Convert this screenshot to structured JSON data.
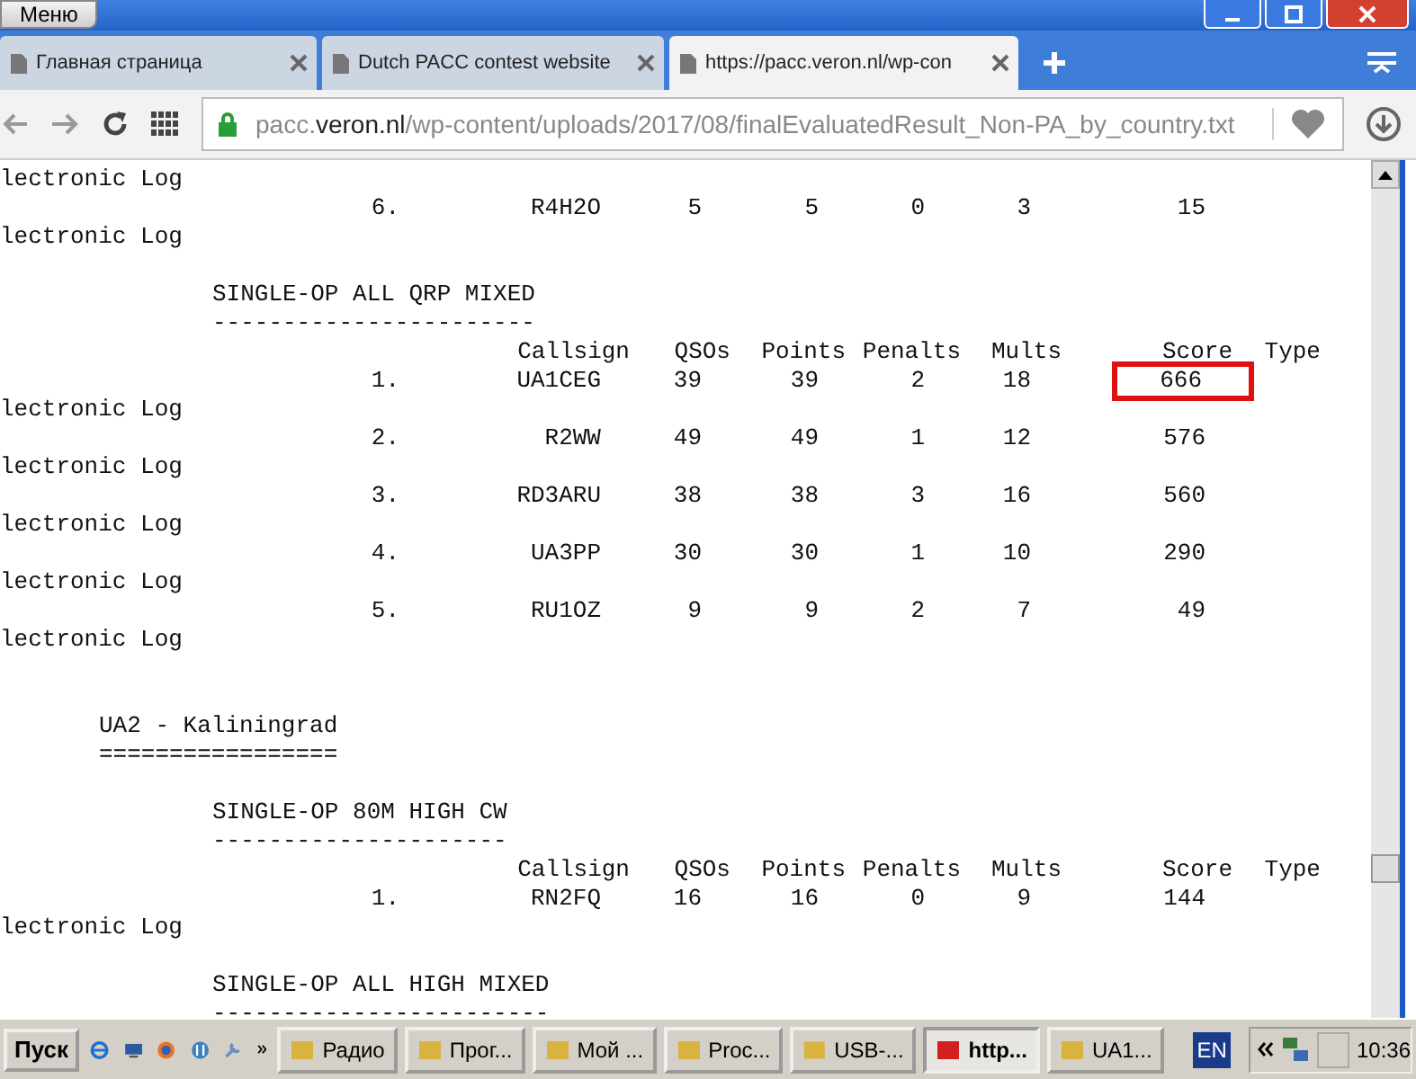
{
  "menu_button": "Меню",
  "tabs": [
    {
      "title": "Главная страница",
      "selected": false
    },
    {
      "title": "Dutch PACC contest website",
      "selected": false
    },
    {
      "title": "https://pacc.veron.nl/wp-con",
      "selected": true
    }
  ],
  "address": {
    "host_start": "pacc.",
    "domain": "veron.nl",
    "path": "/wp-content/uploads/2017/08/finalEvaluatedResult_Non-PA_by_country.txt"
  },
  "document_lines": [
    {
      "kind": "text",
      "text": "lectronic Log"
    },
    {
      "kind": "row",
      "cells": [
        "6.",
        "R4H2O",
        "5",
        "5",
        "0",
        "3",
        "15"
      ],
      "highlighted": false
    },
    {
      "kind": "text",
      "text": "lectronic Log"
    },
    {
      "kind": "blank"
    },
    {
      "kind": "heading",
      "text": "SINGLE-OP ALL QRP MIXED"
    },
    {
      "kind": "heading",
      "text": "-----------------------"
    },
    {
      "kind": "header",
      "cells": [
        "Callsign",
        "QSOs",
        "Points",
        "Penalts",
        "Mults",
        "Score",
        "Type"
      ]
    },
    {
      "kind": "row",
      "cells": [
        "1.",
        "UA1CEG",
        "39",
        "39",
        "2",
        "18",
        "666"
      ],
      "highlighted": true
    },
    {
      "kind": "text",
      "text": "lectronic Log"
    },
    {
      "kind": "row",
      "cells": [
        "2.",
        "R2WW",
        "49",
        "49",
        "1",
        "12",
        "576"
      ],
      "highlighted": false
    },
    {
      "kind": "text",
      "text": "lectronic Log"
    },
    {
      "kind": "row",
      "cells": [
        "3.",
        "RD3ARU",
        "38",
        "38",
        "3",
        "16",
        "560"
      ],
      "highlighted": false
    },
    {
      "kind": "text",
      "text": "lectronic Log"
    },
    {
      "kind": "row",
      "cells": [
        "4.",
        "UA3PP",
        "30",
        "30",
        "1",
        "10",
        "290"
      ],
      "highlighted": false
    },
    {
      "kind": "text",
      "text": "lectronic Log"
    },
    {
      "kind": "row",
      "cells": [
        "5.",
        "RU1OZ",
        "9",
        "9",
        "2",
        "7",
        "49"
      ],
      "highlighted": false
    },
    {
      "kind": "text",
      "text": "lectronic Log"
    },
    {
      "kind": "blank"
    },
    {
      "kind": "blank"
    },
    {
      "kind": "section",
      "text": "UA2 - Kaliningrad"
    },
    {
      "kind": "section",
      "text": "================="
    },
    {
      "kind": "blank"
    },
    {
      "kind": "heading",
      "text": "SINGLE-OP 80M HIGH CW"
    },
    {
      "kind": "heading",
      "text": "---------------------"
    },
    {
      "kind": "header",
      "cells": [
        "Callsign",
        "QSOs",
        "Points",
        "Penalts",
        "Mults",
        "Score",
        "Type"
      ]
    },
    {
      "kind": "row",
      "cells": [
        "1.",
        "RN2FQ",
        "16",
        "16",
        "0",
        "9",
        "144"
      ],
      "highlighted": false
    },
    {
      "kind": "text",
      "text": "lectronic Log"
    },
    {
      "kind": "blank"
    },
    {
      "kind": "heading",
      "text": "SINGLE-OP ALL HIGH MIXED"
    },
    {
      "kind": "heading",
      "text": "------------------------"
    }
  ],
  "taskbar": {
    "start": "Пуск",
    "tasks": [
      {
        "label": "Радио",
        "selected": false
      },
      {
        "label": "Прог...",
        "selected": false
      },
      {
        "label": "Мой ...",
        "selected": false
      },
      {
        "label": "Proc...",
        "selected": false
      },
      {
        "label": "USB-...",
        "selected": false
      },
      {
        "label": "http...",
        "selected": true
      },
      {
        "label": "UA1...",
        "selected": false
      }
    ],
    "language": "EN",
    "clock": "10:36"
  }
}
